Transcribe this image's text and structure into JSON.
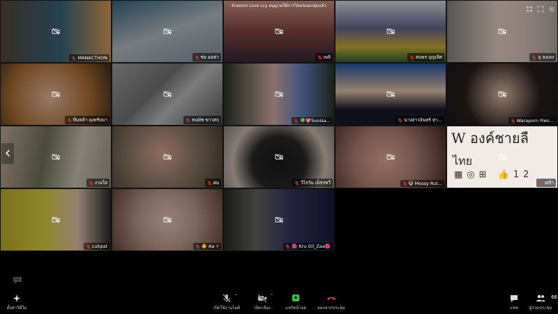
{
  "meeting": {
    "banner": "Krasorn Love Lcy อนุญาตให้การไหมขนมกลุ่มแล้ว"
  },
  "participants": [
    {
      "name": "MANACTHON",
      "bg": "linear-gradient(90deg,#5b4a3a,#3d6b85 55%,#e6a35b)"
    },
    {
      "name": "ช่อ ออฟา",
      "bg": "linear-gradient(160deg,#3a6a8a,#c0c8cc 50%,#8a9aa8)"
    },
    {
      "name": "เพลิ",
      "bg": "linear-gradient(180deg,#d99a8a,#8a4a48 50%,#3a2a3a)",
      "banner": true
    },
    {
      "name": "สมพร บุญเลิศ",
      "bg": "linear-gradient(180deg,#e8e8f0,#6a6a9a 45%,#d8b83a 75%,#3a6a3a)"
    },
    {
      "name": "อุ ลงเลง",
      "bg": "linear-gradient(90deg,#8a8a8a,#f0dcd0 45%,#e8d0c8 70%,#b8b0a8)"
    },
    {
      "name": "ทีมหล้า ลุงหรับบา",
      "bg": "radial-gradient(circle at 45% 55%,#f3c3a8,#b8783a 55%,#3e2a1a)"
    },
    {
      "name": "ธนพัช ขาวสกุ",
      "bg": "linear-gradient(135deg,#a8a8a8,#7a7a7a 40%,#c8c8c8 60%,#5a5a5a)"
    },
    {
      "name": "🍀💖Sunisa...",
      "bg": "linear-gradient(90deg,#2a3a2a,#e0b8b0 45%,#6a88c8 70%,#2a3a2a)"
    },
    {
      "name": "นางสาวจันทร์ ทา...",
      "bg": "linear-gradient(180deg,#2a58a8,#f2d0b8 45%,#1a1a2a 75%)"
    },
    {
      "name": "Waraporn Pien...",
      "bg": "radial-gradient(circle at 50% 50%,#f0c8b0,#2a2020 60%,#1a1a1a)"
    },
    {
      "name": "งามใส",
      "bg": "linear-gradient(100deg,#c8b8a0,#7a7860 40%,#d8d0c0 70%,#a8a090)"
    },
    {
      "name": "ฝน",
      "bg": "radial-gradient(circle at 45% 45%,#e8b098,#8a7868 55%,#4a4030)"
    },
    {
      "name": "วิไรวัน เพ็ชรทวี",
      "bg": "radial-gradient(circle at 50% 60%,#1a1a1a,#2a2a2a 40%,#d8c8b8 70%,#8a8888)"
    },
    {
      "name": "😺 Mossy Rut...",
      "bg": "radial-gradient(circle at 45% 55%,#f0b8a0,#b8887a 45%,#4a2a28)"
    },
    {
      "name": "เศร้า",
      "bg": "#f0ebe6",
      "card": true
    },
    {
      "name": "Lukpat",
      "bg": "linear-gradient(90deg,#c8b830,#e8d848 40%,#f0d0b8 70%,#2a2a2a)"
    },
    {
      "name": "🐥 Aa ⚡",
      "bg": "radial-gradient(circle at 50% 50%,#f0d0c0,#c8a898 45%,#6a4a3a)"
    },
    {
      "name": "🌺 Kru Oil_Zaa🌺",
      "bg": "linear-gradient(90deg,#2a2a28,#6a6a68 30%,#3a3a68 60%,#1a1a3a)"
    }
  ],
  "card_text": {
    "line1": "W  องค์ชายลื",
    "line2": "ไทย",
    "icons": "▦◎⊞ 👍12"
  },
  "nav": {
    "prev_arrow": "‹"
  },
  "toolbar": {
    "settings_label": "ตั้งค่าวิดีโอ",
    "mic_label": "เปิดใช้งานไมค์",
    "video_label": "เปิดกล้อง",
    "share_label": "แชร์หน้าจอ",
    "leave_label": "ออกจากประชุม",
    "chat_label": "แชท",
    "participants_label": "ผู้ร่วมประชุม",
    "participants_count": "66"
  },
  "colors": {
    "share_green": "#3ec04a",
    "leave_red": "#e03a3a"
  }
}
